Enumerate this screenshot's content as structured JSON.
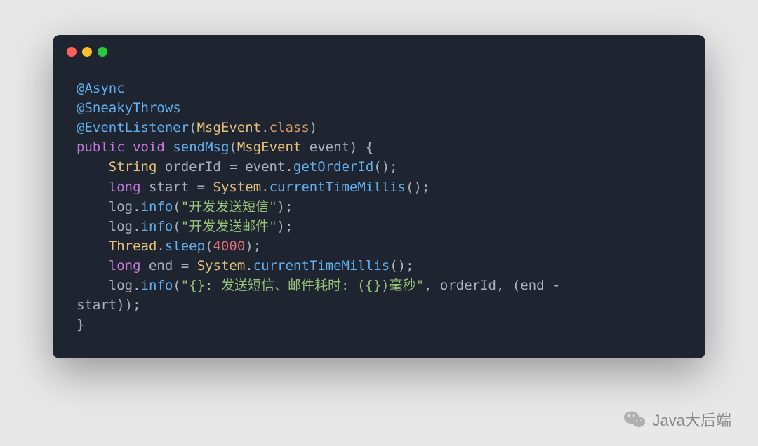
{
  "window": {
    "dots": [
      "red",
      "yellow",
      "green"
    ]
  },
  "code": {
    "line1": {
      "annotation": "@Async"
    },
    "line2": {
      "annotation": "@SneakyThrows"
    },
    "line3": {
      "annotation": "@EventListener",
      "p1": "(",
      "param": "MsgEvent",
      "dot": ".",
      "klass": "class",
      "p2": ")"
    },
    "line4": {
      "kw1": "public",
      "kw2": "void",
      "method": "sendMsg",
      "p1": "(",
      "type": "MsgEvent",
      "param": " event",
      "p2": ") {"
    },
    "line5": {
      "indent": "    ",
      "type": "String",
      "var": " orderId ",
      "eq": "= event.",
      "method": "getOrderId",
      "p": "();"
    },
    "line6": {
      "indent": "    ",
      "kw": "long",
      "var": " start ",
      "eq": "= ",
      "cls": "System",
      "dot": ".",
      "method": "currentTimeMillis",
      "p": "();"
    },
    "line7": {
      "indent": "    ",
      "obj": "log.",
      "method": "info",
      "p1": "(",
      "str": "\"开发发送短信\"",
      "p2": ");"
    },
    "line8": {
      "indent": "    ",
      "obj": "log.",
      "method": "info",
      "p1": "(",
      "str": "\"开发发送邮件\"",
      "p2": ");"
    },
    "line9": {
      "indent": "    ",
      "cls": "Thread",
      "dot": ".",
      "method": "sleep",
      "p1": "(",
      "num": "4000",
      "p2": ");"
    },
    "line10": {
      "indent": "    ",
      "kw": "long",
      "var": " end ",
      "eq": "= ",
      "cls": "System",
      "dot": ".",
      "method": "currentTimeMillis",
      "p": "();"
    },
    "line11": {
      "indent": "    ",
      "obj": "log.",
      "method": "info",
      "p1": "(",
      "str": "\"{}: 发送短信、邮件耗时: ({})毫秒\"",
      "c1": ", orderId, (end - "
    },
    "line12": {
      "txt": "start));"
    },
    "line13": {
      "txt": "}"
    }
  },
  "watermark": {
    "text": "Java大后端",
    "icon": "wechat-icon"
  }
}
